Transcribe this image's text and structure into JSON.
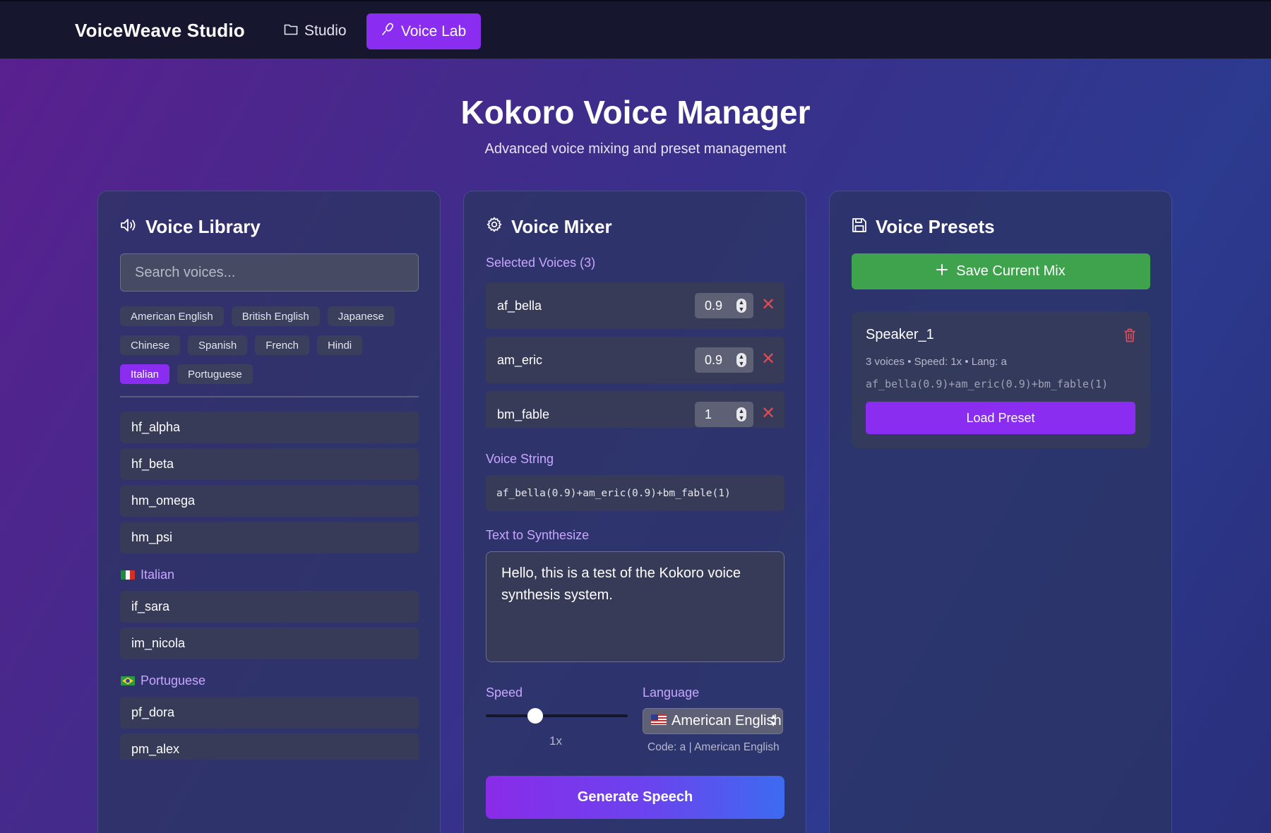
{
  "nav": {
    "brand": "VoiceWeave Studio",
    "studio_label": "Studio",
    "voice_lab_label": "Voice Lab",
    "studio_icon": "folder-icon",
    "voice_lab_icon": "microphone-icon"
  },
  "header": {
    "title": "Kokoro Voice Manager",
    "subtitle": "Advanced voice mixing and preset management"
  },
  "library": {
    "title": "Voice Library",
    "icon": "speaker-icon",
    "search_placeholder": "Search voices...",
    "language_filters": [
      {
        "label": "American English",
        "active": false
      },
      {
        "label": "British English",
        "active": false
      },
      {
        "label": "Japanese",
        "active": false
      },
      {
        "label": "Chinese",
        "active": false
      },
      {
        "label": "Spanish",
        "active": false
      },
      {
        "label": "French",
        "active": false
      },
      {
        "label": "Hindi",
        "active": false
      },
      {
        "label": "Italian",
        "active": true
      },
      {
        "label": "Portuguese",
        "active": false
      }
    ],
    "voices_top": [
      "hf_alpha",
      "hf_beta",
      "hm_omega",
      "hm_psi"
    ],
    "groups": [
      {
        "name": "Italian",
        "flag": "italy-flag-icon",
        "voices": [
          "if_sara",
          "im_nicola"
        ]
      },
      {
        "name": "Portuguese",
        "flag": "brazil-flag-icon",
        "voices": [
          "pf_dora",
          "pm_alex"
        ]
      }
    ]
  },
  "mixer": {
    "title": "Voice Mixer",
    "icon": "gear-icon",
    "selected_label": "Selected Voices (3)",
    "selected": [
      {
        "name": "af_bella",
        "weight": "0.9"
      },
      {
        "name": "am_eric",
        "weight": "0.9"
      },
      {
        "name": "bm_fable",
        "weight": "1"
      }
    ],
    "voice_string_label": "Voice String",
    "voice_string": "af_bella(0.9)+am_eric(0.9)+bm_fable(1)",
    "text_label": "Text to Synthesize",
    "text": "Hello, this is a test of the Kokoro voice synthesis system.",
    "speed_label": "Speed",
    "speed_value": "1x",
    "speed_fraction": 0.35,
    "language_label": "Language",
    "language_selected": "American English",
    "language_flag": "us-flag-icon",
    "language_code": "Code: a | American English",
    "generate_label": "Generate Speech"
  },
  "presets": {
    "title": "Voice Presets",
    "icon": "floppy-disk-icon",
    "save_label": "Save Current Mix",
    "items": [
      {
        "name": "Speaker_1",
        "meta": "3 voices • Speed: 1x • Lang: a",
        "voice_string": "af_bella(0.9)+am_eric(0.9)+bm_fable(1)",
        "load_label": "Load Preset"
      }
    ]
  },
  "colors": {
    "accent_purple": "#8b2df0",
    "save_green": "#3fa34d",
    "remove_red": "#e04c55",
    "label_purple": "#c8a6ff"
  }
}
